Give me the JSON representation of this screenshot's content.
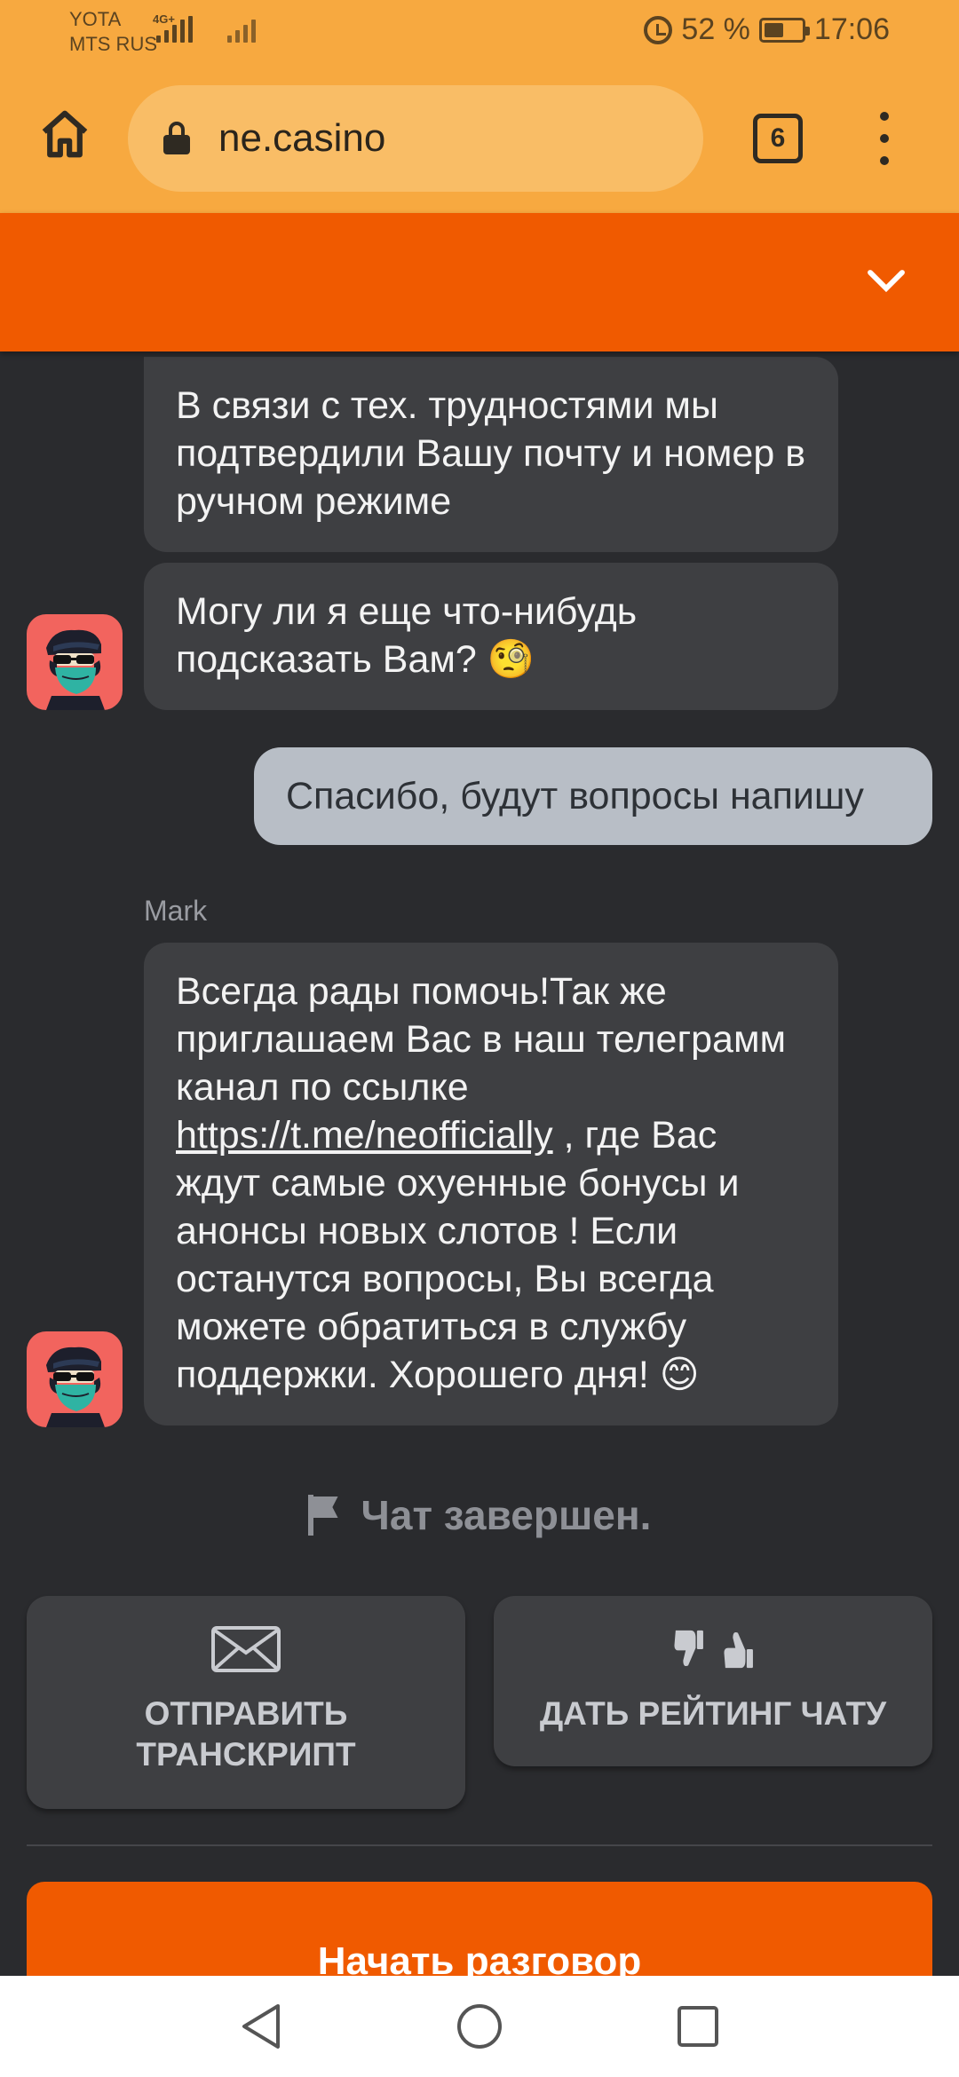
{
  "status_bar": {
    "carrier_1": "YOTA",
    "carrier_2": "MTS RUS",
    "network": "4G+",
    "battery": "52 %",
    "time": "17:06"
  },
  "browser": {
    "url": "ne.casino",
    "tab_count": "6"
  },
  "chat": {
    "messages": [
      {
        "text": "В связи с тех. трудностями мы подтвердили Вашу почту и номер в ручном режиме"
      },
      {
        "text": "Могу ли я еще что-нибудь подсказать Вам? 🧐"
      },
      {
        "text": "Спасибо, будут вопросы напишу"
      },
      {
        "text_before": "Всегда рады помочь!Так же приглашаем Вас в наш телеграмм канал по ссылке ",
        "link": "https://t.me/neofficially",
        "text_after": " , где Вас ждут самые охуенные бонусы и анонсы новых слотов ! Если останутся вопросы, Вы всегда можете обратиться в службу поддержки. Хорошего дня! 😊"
      }
    ],
    "agent_name": "Mark",
    "ended_text": "Чат завершен."
  },
  "actions": {
    "send_transcript": "ОТПРАВИТЬ ТРАНСКРИПТ",
    "rate_chat": "ДАТЬ РЕЙТИНГ ЧАТУ",
    "start_chat": "Начать разговор"
  },
  "colors": {
    "accent": "#f05a00",
    "browser_bar": "#f7a940",
    "background": "#2a2b2e",
    "agent_bubble": "#3e3f42",
    "user_bubble": "#b8bec6"
  }
}
